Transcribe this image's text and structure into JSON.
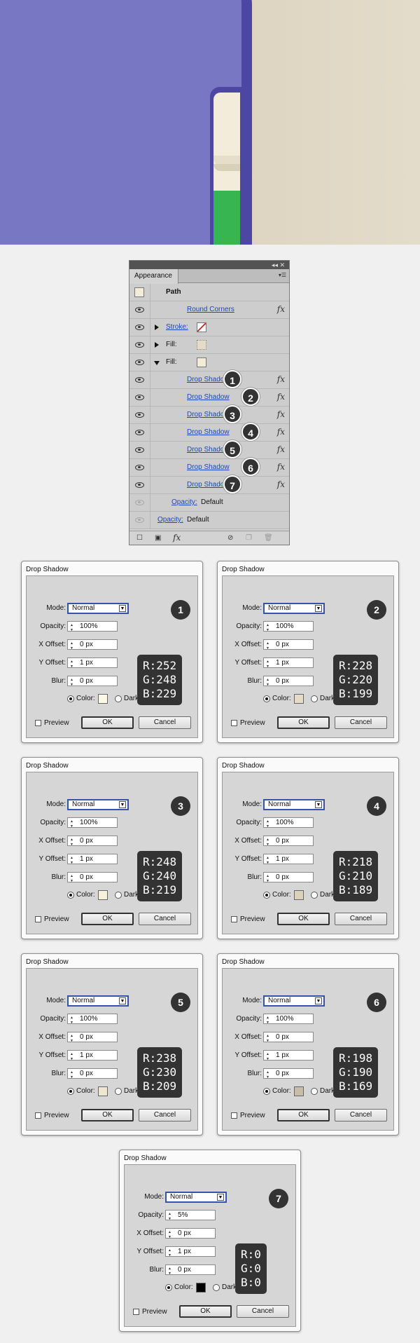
{
  "panel": {
    "title": "Appearance",
    "top_controls": "◂◂ ✕",
    "menu_icon": "hamburger-icon",
    "path_label": "Path",
    "effect_rows": [
      {
        "label": "Round Corners",
        "link": true,
        "fx": "fx",
        "badge": ""
      },
      {
        "label": "Stroke:",
        "link": true,
        "fx": "",
        "badge": ""
      },
      {
        "label": "Fill:",
        "link": false,
        "fx": "",
        "badge": ""
      },
      {
        "label": "Fill:",
        "link": false,
        "fx": "",
        "badge": ""
      },
      {
        "label": "Drop Shadow",
        "link": true,
        "fx": "fx",
        "badge": "1"
      },
      {
        "label": "Drop Shadow",
        "link": true,
        "fx": "fx",
        "badge": "2"
      },
      {
        "label": "Drop Shadow",
        "link": true,
        "fx": "fx",
        "badge": "3"
      },
      {
        "label": "Drop Shadow",
        "link": true,
        "fx": "fx",
        "badge": "4"
      },
      {
        "label": "Drop Shadow",
        "link": true,
        "fx": "fx",
        "badge": "5"
      },
      {
        "label": "Drop Shadow",
        "link": true,
        "fx": "fx",
        "badge": "6"
      },
      {
        "label": "Drop Shadow",
        "link": true,
        "fx": "fx",
        "badge": "7"
      }
    ],
    "opacity_label": "Opacity:",
    "opacity_value": "Default",
    "bottom_fx": "fx"
  },
  "dialogs": [
    {
      "title": "Drop Shadow",
      "badge": "1",
      "mode_label": "Mode:",
      "mode": "Normal",
      "opacity_label": "Opacity:",
      "opacity": "100%",
      "x_label": "X Offset:",
      "x": "0 px",
      "y_label": "Y Offset:",
      "y": "1 px",
      "blur_label": "Blur:",
      "blur": "0 px",
      "color_label": "Color:",
      "darkness_label": "Dark",
      "preview_label": "Preview",
      "ok": "OK",
      "cancel": "Cancel",
      "r": "R:252",
      "g": "G:248",
      "b": "B:229",
      "swatch": "#fcf8e5"
    },
    {
      "title": "Drop Shadow",
      "badge": "2",
      "mode_label": "Mode:",
      "mode": "Normal",
      "opacity_label": "Opacity:",
      "opacity": "100%",
      "x_label": "X Offset:",
      "x": "0 px",
      "y_label": "Y Offset:",
      "y": "1 px",
      "blur_label": "Blur:",
      "blur": "0 px",
      "color_label": "Color:",
      "darkness_label": "Dark",
      "preview_label": "Preview",
      "ok": "OK",
      "cancel": "Cancel",
      "r": "R:228",
      "g": "G:220",
      "b": "B:199",
      "swatch": "#e4dcc7"
    },
    {
      "title": "Drop Shadow",
      "badge": "3",
      "mode_label": "Mode:",
      "mode": "Normal",
      "opacity_label": "Opacity:",
      "opacity": "100%",
      "x_label": "X Offset:",
      "x": "0 px",
      "y_label": "Y Offset:",
      "y": "1 px",
      "blur_label": "Blur:",
      "blur": "0 px",
      "color_label": "Color:",
      "darkness_label": "Dark",
      "preview_label": "Preview",
      "ok": "OK",
      "cancel": "Cancel",
      "r": "R:248",
      "g": "G:240",
      "b": "B:219",
      "swatch": "#f8f0db"
    },
    {
      "title": "Drop Shadow",
      "badge": "4",
      "mode_label": "Mode:",
      "mode": "Normal",
      "opacity_label": "Opacity:",
      "opacity": "100%",
      "x_label": "X Offset:",
      "x": "0 px",
      "y_label": "Y Offset:",
      "y": "1 px",
      "blur_label": "Blur:",
      "blur": "0 px",
      "color_label": "Color:",
      "darkness_label": "Dark",
      "preview_label": "Preview",
      "ok": "OK",
      "cancel": "Cancel",
      "r": "R:218",
      "g": "G:210",
      "b": "B:189",
      "swatch": "#dad2bd"
    },
    {
      "title": "Drop Shadow",
      "badge": "5",
      "mode_label": "Mode:",
      "mode": "Normal",
      "opacity_label": "Opacity:",
      "opacity": "100%",
      "x_label": "X Offset:",
      "x": "0 px",
      "y_label": "Y Offset:",
      "y": "1 px",
      "blur_label": "Blur:",
      "blur": "0 px",
      "color_label": "Color:",
      "darkness_label": "Dark",
      "preview_label": "Preview",
      "ok": "OK",
      "cancel": "Cancel",
      "r": "R:238",
      "g": "G:230",
      "b": "B:209",
      "swatch": "#eee6d1"
    },
    {
      "title": "Drop Shadow",
      "badge": "6",
      "mode_label": "Mode:",
      "mode": "Normal",
      "opacity_label": "Opacity:",
      "opacity": "100%",
      "x_label": "X Offset:",
      "x": "0 px",
      "y_label": "Y Offset:",
      "y": "1 px",
      "blur_label": "Blur:",
      "blur": "0 px",
      "color_label": "Color:",
      "darkness_label": "Dark",
      "preview_label": "Preview",
      "ok": "OK",
      "cancel": "Cancel",
      "r": "R:198",
      "g": "G:190",
      "b": "B:169",
      "swatch": "#c6bea9"
    },
    {
      "title": "Drop Shadow",
      "badge": "7",
      "mode_label": "Mode:",
      "mode": "Normal",
      "opacity_label": "Opacity:",
      "opacity": "5%",
      "x_label": "X Offset:",
      "x": "0 px",
      "y_label": "Y Offset:",
      "y": "1 px",
      "blur_label": "Blur:",
      "blur": "0 px",
      "color_label": "Color:",
      "darkness_label": "Darkness",
      "preview_label": "Preview",
      "ok": "OK",
      "cancel": "Cancel",
      "r": "R:0",
      "g": "G:0",
      "b": "B:0",
      "swatch": "#000000"
    }
  ]
}
